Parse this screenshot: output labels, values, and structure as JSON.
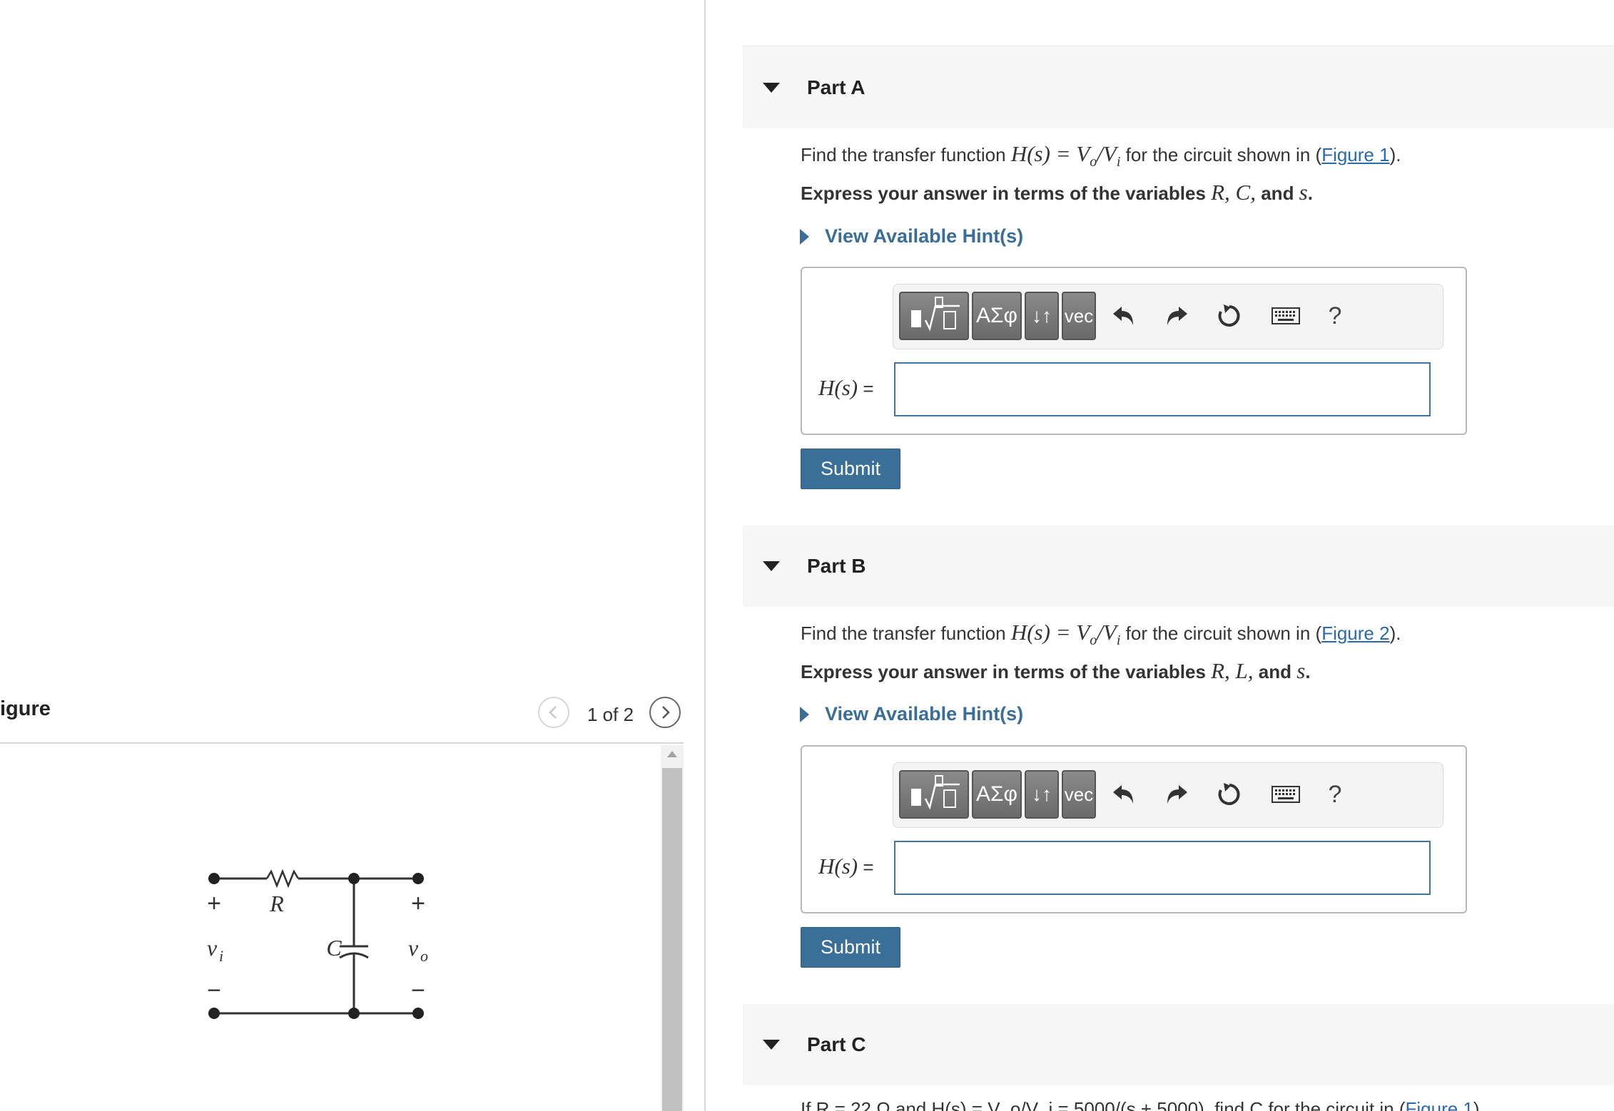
{
  "figure_pane": {
    "title": "igure",
    "counter": "1 of 2",
    "prev_icon": "chevron-left-icon",
    "next_icon": "chevron-right-icon",
    "circuit": {
      "resistor": "R",
      "capacitor": "C",
      "input": "v",
      "input_sub": "i",
      "output": "v",
      "output_sub": "o",
      "plus": "+",
      "minus": "−"
    }
  },
  "parts": [
    {
      "title": "Part A",
      "prompt_pre": "Find the transfer function ",
      "prompt_math": "H(s) = V",
      "prompt_sub1": "o",
      "prompt_math2": "/V",
      "prompt_sub2": "i",
      "prompt_mid": " for the circuit shown in (",
      "figure_link": "Figure 1",
      "prompt_post": ").",
      "instr_pre": "Express your answer in terms of the variables ",
      "instr_vars": "R, C,",
      "instr_and": " and ",
      "instr_last": "s",
      "instr_end": ".",
      "hint": "View Available Hint(s)",
      "answer_label_math": "H(s)",
      "answer_label_eq": " =",
      "answer_value": "",
      "submit": "Submit"
    },
    {
      "title": "Part B",
      "prompt_pre": "Find the transfer function ",
      "prompt_math": "H(s) = V",
      "prompt_sub1": "o",
      "prompt_math2": "/V",
      "prompt_sub2": "i",
      "prompt_mid": " for the circuit shown in (",
      "figure_link": "Figure 2",
      "prompt_post": ").",
      "instr_pre": "Express your answer in terms of the variables ",
      "instr_vars": "R, L,",
      "instr_and": " and ",
      "instr_last": "s",
      "instr_end": ".",
      "hint": "View Available Hint(s)",
      "answer_label_math": "H(s)",
      "answer_label_eq": " =",
      "answer_value": "",
      "submit": "Submit"
    },
    {
      "title": "Part C",
      "prompt_partial": "If R = 22 Ω and H(s) = V_o/V_i = 5000/(s + 5000), find C for the circuit in (",
      "figure_link": "Figure 1",
      "prompt_post": ")."
    }
  ],
  "toolbar": {
    "templates_icon": "fraction-sqrt-template-icon",
    "greek": "ΑΣφ",
    "arrows": "↓↑",
    "vec": "vec",
    "undo_icon": "undo-icon",
    "redo_icon": "redo-icon",
    "reset_icon": "reset-icon",
    "keyboard_icon": "keyboard-icon",
    "help": "?"
  }
}
